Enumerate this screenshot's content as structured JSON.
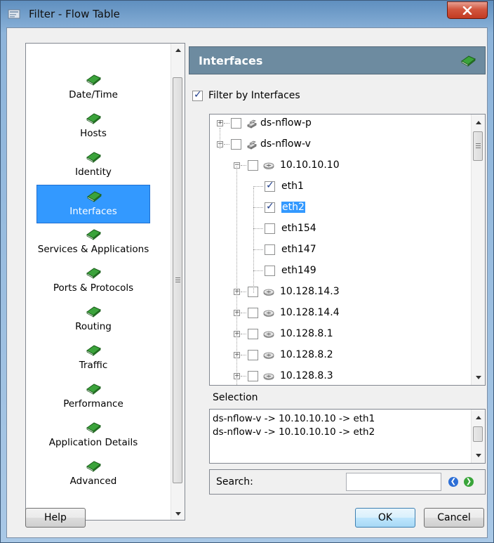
{
  "window": {
    "title": "Filter - Flow Table"
  },
  "nav": {
    "items": [
      {
        "label": "Date/Time",
        "selected": false
      },
      {
        "label": "Hosts",
        "selected": false
      },
      {
        "label": "Identity",
        "selected": false
      },
      {
        "label": "Interfaces",
        "selected": true
      },
      {
        "label": "Services & Applications",
        "selected": false
      },
      {
        "label": "Ports & Protocols",
        "selected": false
      },
      {
        "label": "Routing",
        "selected": false
      },
      {
        "label": "Traffic",
        "selected": false
      },
      {
        "label": "Performance",
        "selected": false
      },
      {
        "label": "Application Details",
        "selected": false
      },
      {
        "label": "Advanced",
        "selected": false
      }
    ]
  },
  "panel": {
    "title": "Interfaces",
    "filter_label": "Filter by Interfaces",
    "filter_checked": true
  },
  "tree": {
    "nodes": [
      {
        "label": "ds-nflow-p",
        "level": 0,
        "expander": "+",
        "checked": false,
        "icon": "device-icon"
      },
      {
        "label": "ds-nflow-v",
        "level": 0,
        "expander": "-",
        "checked": false,
        "icon": "device-icon"
      },
      {
        "label": "10.10.10.10",
        "level": 1,
        "expander": "-",
        "checked": false,
        "icon": "router-icon"
      },
      {
        "label": "eth1",
        "level": 2,
        "checked": true
      },
      {
        "label": "eth2",
        "level": 2,
        "checked": true,
        "highlighted": true
      },
      {
        "label": "eth154",
        "level": 2,
        "checked": false
      },
      {
        "label": "eth147",
        "level": 2,
        "checked": false
      },
      {
        "label": "eth149",
        "level": 2,
        "checked": false
      },
      {
        "label": "10.128.14.3",
        "level": 1,
        "expander": "+",
        "checked": false,
        "icon": "router-icon"
      },
      {
        "label": "10.128.14.4",
        "level": 1,
        "expander": "+",
        "checked": false,
        "icon": "router-icon"
      },
      {
        "label": "10.128.8.1",
        "level": 1,
        "expander": "+",
        "checked": false,
        "icon": "router-icon"
      },
      {
        "label": "10.128.8.2",
        "level": 1,
        "expander": "+",
        "checked": false,
        "icon": "router-icon"
      },
      {
        "label": "10.128.8.3",
        "level": 1,
        "expander": "+",
        "checked": false,
        "icon": "router-icon"
      }
    ]
  },
  "selection": {
    "label": "Selection",
    "lines": [
      "ds-nflow-v -> 10.10.10.10 -> eth1",
      "ds-nflow-v -> 10.10.10.10 -> eth2"
    ]
  },
  "search": {
    "label": "Search:",
    "value": ""
  },
  "buttons": {
    "help": "Help",
    "ok": "OK",
    "cancel": "Cancel"
  },
  "colors": {
    "selection": "#3399ff",
    "header": "#6d8ba0",
    "book_green": "#2e8b2e"
  }
}
